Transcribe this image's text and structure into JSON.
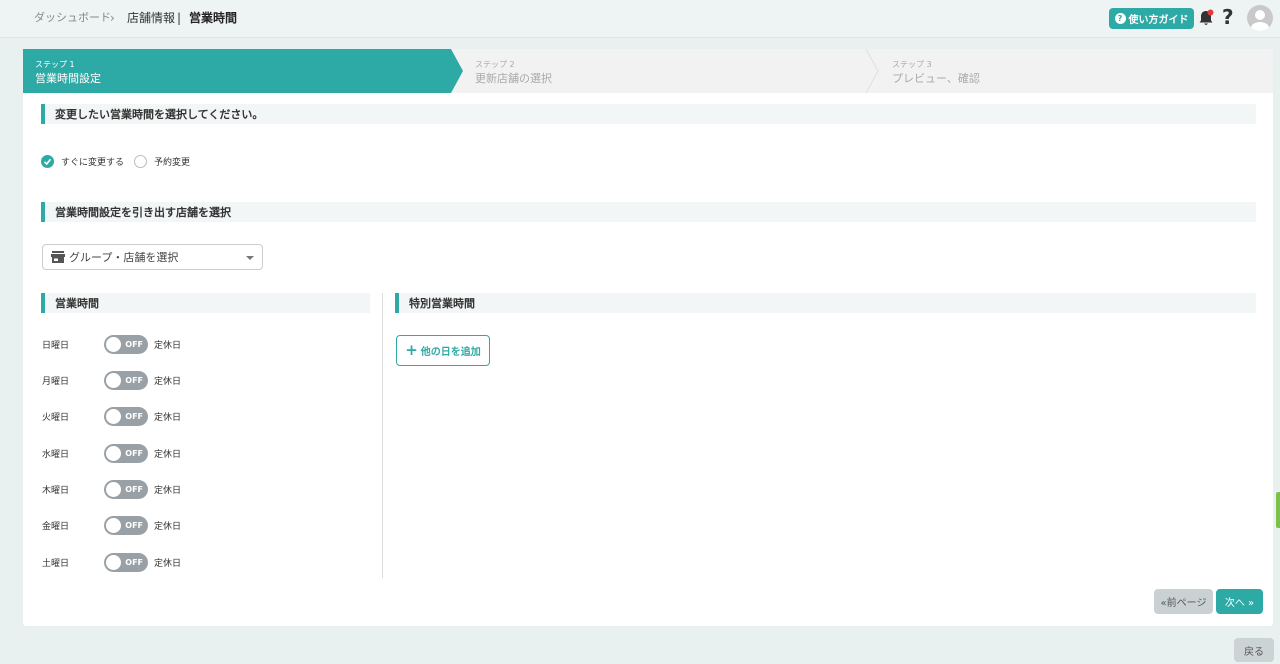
{
  "breadcrumb": {
    "home": "ダッシュボード",
    "separator": "›",
    "parent": "店舗情報",
    "divider": "|",
    "current": "営業時間"
  },
  "header": {
    "guide_label": "使い方ガイド",
    "help_label": "?",
    "accent_color": "#2eaaa6"
  },
  "steps": [
    {
      "number": "ステップ 1",
      "label": "営業時間設定",
      "active": true
    },
    {
      "number": "ステップ 2",
      "label": "更新店舗の選択",
      "active": false
    },
    {
      "number": "ステップ 3",
      "label": "プレビュー、確認",
      "active": false
    }
  ],
  "section_change": {
    "title": "変更したい営業時間を選択してください。"
  },
  "change_mode": {
    "options": [
      {
        "label": "すぐに変更する",
        "selected": true
      },
      {
        "label": "予約変更",
        "selected": false
      }
    ]
  },
  "section_source": {
    "title": "営業時間設定を引き出す店舗を選択"
  },
  "store_select": {
    "placeholder": "グループ・店舗を選択"
  },
  "hours": {
    "title": "営業時間",
    "toggle_label": "OFF",
    "rest_label": "定休日",
    "days": [
      {
        "label": "日曜日",
        "on": false
      },
      {
        "label": "月曜日",
        "on": false
      },
      {
        "label": "火曜日",
        "on": false
      },
      {
        "label": "水曜日",
        "on": false
      },
      {
        "label": "木曜日",
        "on": false
      },
      {
        "label": "金曜日",
        "on": false
      },
      {
        "label": "土曜日",
        "on": false
      }
    ]
  },
  "special_hours": {
    "title": "特別営業時間",
    "add_label": "他の日を追加"
  },
  "footer": {
    "prev_label": "«前ページ",
    "next_label": "次へ »",
    "back_label": "戻る"
  }
}
